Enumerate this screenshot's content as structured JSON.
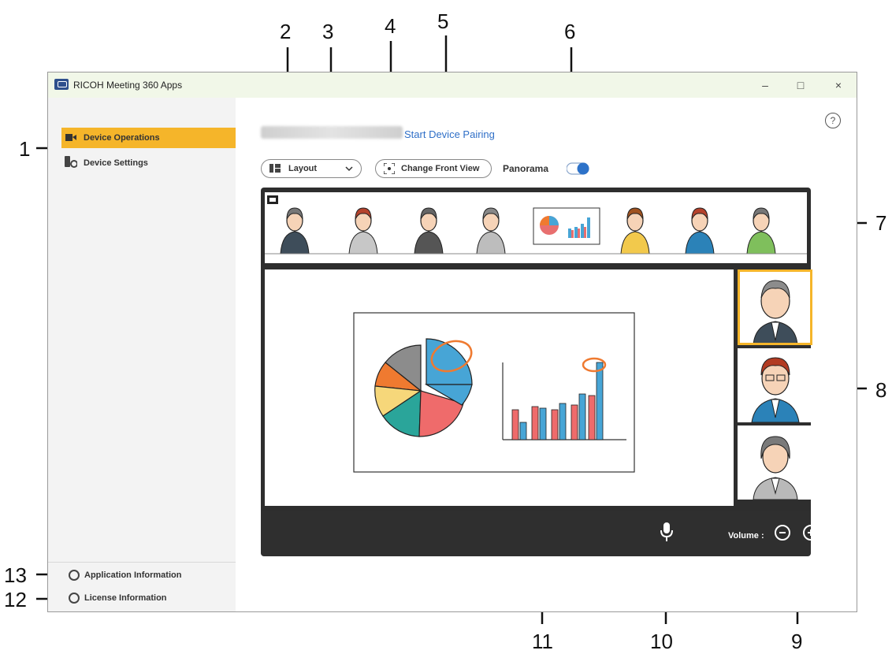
{
  "window": {
    "title": "RICOH Meeting 360 Apps",
    "controls": [
      "–",
      "□",
      "×"
    ]
  },
  "sidebar": {
    "items": [
      {
        "label": "Device Operations",
        "selected": true
      },
      {
        "label": "Device Settings",
        "selected": false
      }
    ],
    "bottom": [
      {
        "label": "Application Information"
      },
      {
        "label": "License Information"
      }
    ]
  },
  "header": {
    "pairing_link": "Start Device Pairing",
    "help": "?"
  },
  "toolbar": {
    "layout_label": "Layout",
    "change_front_view_label": "Change Front View",
    "panorama_label": "Panorama",
    "panorama_on": true
  },
  "controls": {
    "volume_label": "Volume :"
  },
  "callouts": [
    "1",
    "2",
    "3",
    "4",
    "5",
    "6",
    "7",
    "8",
    "9",
    "10",
    "11",
    "12",
    "13"
  ],
  "colors": {
    "selected_nav": "#f5b52a",
    "link": "#2f6fc7",
    "toggle": "#2d72c9",
    "control_bar": "#2f2f2f"
  }
}
